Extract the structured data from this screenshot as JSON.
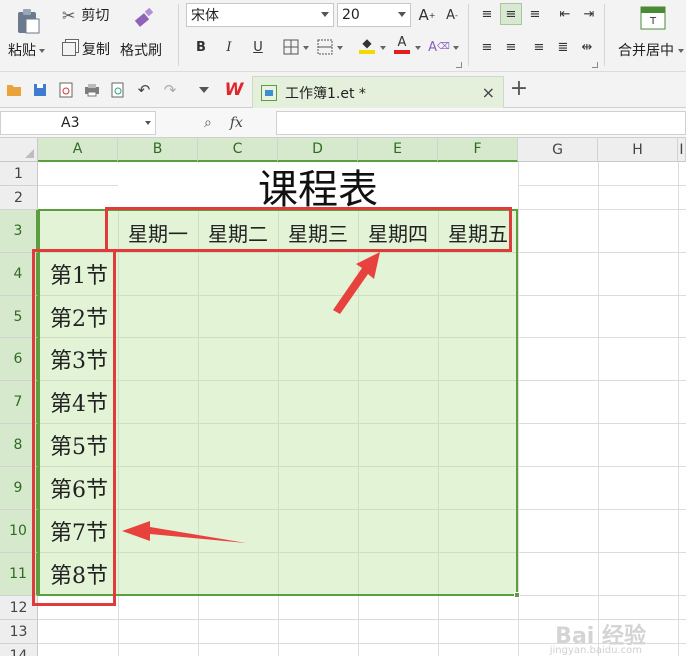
{
  "ribbon": {
    "paste_label": "粘贴",
    "cut_label": "剪切",
    "copy_label": "复制",
    "format_painter_label": "格式刷",
    "font_name": "宋体",
    "font_size": "20",
    "bold": "B",
    "italic": "I",
    "underline": "U",
    "merge_center_label": "合并居中"
  },
  "tabbar": {
    "app_logo": "W",
    "document_title": "工作簿1.et *",
    "close_glyph": "×",
    "new_tab_glyph": "+"
  },
  "formula_bar": {
    "cell_reference": "A3",
    "fx_label": "fx",
    "formula_value": ""
  },
  "grid": {
    "columns": [
      "A",
      "B",
      "C",
      "D",
      "E",
      "F",
      "G",
      "H",
      "I"
    ],
    "rows": [
      "1",
      "2",
      "3",
      "4",
      "5",
      "6",
      "7",
      "8",
      "9",
      "10",
      "11",
      "12",
      "13",
      "14"
    ],
    "selected_columns": [
      "A",
      "B",
      "C",
      "D",
      "E",
      "F"
    ],
    "selected_rows": [
      "3",
      "4",
      "5",
      "6",
      "7",
      "8",
      "9",
      "10",
      "11"
    ]
  },
  "sheet": {
    "title": "课程表",
    "days": [
      "星期一",
      "星期二",
      "星期三",
      "星期四",
      "星期五"
    ],
    "periods": [
      "第1节",
      "第2节",
      "第3节",
      "第4节",
      "第5节",
      "第6节",
      "第7节",
      "第8节"
    ]
  },
  "colors": {
    "selection_fill": "#e2f3d6",
    "selection_border": "#5a9e3f",
    "annotation_red": "#e03a3a",
    "ribbon_bg": "#f3f3f3"
  },
  "watermark": {
    "brand": "Bai 经验",
    "url": "jingyan.baidu.com"
  }
}
